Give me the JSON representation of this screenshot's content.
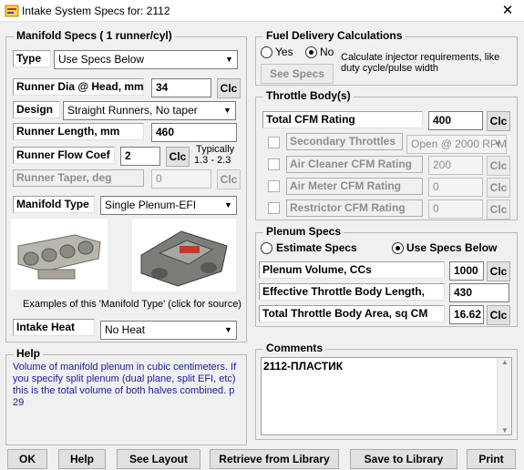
{
  "window": {
    "title": "Intake System Specs for: 2112",
    "close_glyph": "✕"
  },
  "manifold": {
    "group_title": "Manifold Specs ( 1 runner/cyl)",
    "type_label": "Type",
    "type_value": "Use Specs Below",
    "runner_dia_label": "Runner Dia @ Head, mm",
    "runner_dia_value": "34",
    "design_label": "Design",
    "design_value": "Straight Runners, No taper",
    "runner_length_label": "Runner Length, mm",
    "runner_length_value": "460",
    "flow_coef_label": "Runner Flow Coef",
    "flow_coef_value": "2",
    "typically_label": "Typically",
    "typically_range": "1.3 - 2.3",
    "taper_label": "Runner Taper, deg",
    "taper_value": "0",
    "manifold_type_label": "Manifold Type",
    "manifold_type_value": "Single Plenum-EFI",
    "examples_caption": "Examples of this 'Manifold Type' (click for source)",
    "intake_heat_label": "Intake Heat",
    "intake_heat_value": "No Heat"
  },
  "help": {
    "title": "Help",
    "text": "Volume of manifold plenum in cubic centimeters.  If you specify split plenum (dual plane, split EFI, etc) this is the total volume of both halves combined.  p 29"
  },
  "fuel": {
    "group_title": "Fuel Delivery Calculations",
    "yes_label": "Yes",
    "no_label": "No",
    "selected": "No",
    "description": "Calculate injector requirements, like duty cycle/pulse width",
    "see_specs_label": "See Specs"
  },
  "throttle": {
    "group_title": "Throttle Body(s)",
    "total_cfm_label": "Total CFM Rating",
    "total_cfm_value": "400",
    "secondary_label": "Secondary Throttles",
    "secondary_value": "Open @ 2000 RPM",
    "air_cleaner_label": "Air Cleaner CFM Rating",
    "air_cleaner_value": "200",
    "air_meter_label": "Air Meter CFM Rating",
    "air_meter_value": "0",
    "restrictor_label": "Restrictor CFM Rating",
    "restrictor_value": "0"
  },
  "plenum": {
    "group_title": "Plenum Specs",
    "estimate_label": "Estimate Specs",
    "use_specs_label": "Use Specs Below",
    "selected": "Use Specs Below",
    "volume_label": "Plenum Volume, CCs",
    "volume_value": "1000",
    "effective_label": "Effective Throttle Body Length,",
    "effective_value": "430",
    "total_area_label": "Total Throttle Body Area, sq CM",
    "total_area_value": "16.62"
  },
  "comments": {
    "group_title": "Comments",
    "text": "2112-ПЛАСТИК"
  },
  "common": {
    "clc": "Clc",
    "dropdown_glyph": "▼"
  },
  "buttons": {
    "ok": "OK",
    "help": "Help",
    "see_layout": "See Layout",
    "retrieve": "Retrieve from Library",
    "save": "Save to Library",
    "print": "Print"
  },
  "colors": {
    "help_text": "#1a1aa0",
    "disabled_text": "#8d8d8d",
    "background": "#f0f0f0"
  }
}
